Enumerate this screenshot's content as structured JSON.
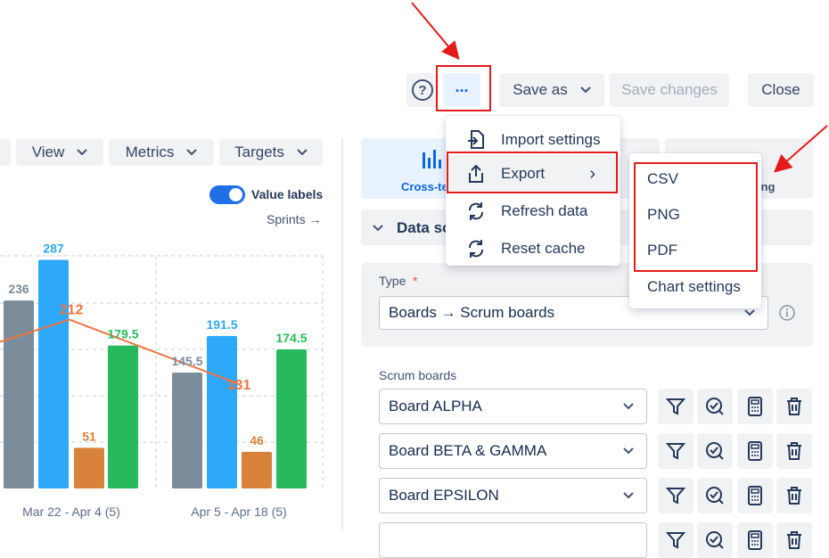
{
  "toolbar": {
    "help_icon": "help-circle-icon",
    "more_label": "...",
    "save_as_label": "Save as",
    "save_changes_label": "Save changes",
    "close_label": "Close"
  },
  "left_toolbar": {
    "view_label": "View",
    "metrics_label": "Metrics",
    "targets_label": "Targets"
  },
  "value_labels": {
    "label": "Value labels",
    "enabled": true
  },
  "sprints_link": "Sprints →",
  "chart_data": {
    "type": "bar",
    "categories": [
      "Mar 22 - Apr 4 (5)",
      "Apr 5 - Apr 18 (5)"
    ],
    "series": [
      {
        "color": "#7b8c9a",
        "values": [
          236,
          145.5
        ]
      },
      {
        "color": "#2ea8f8",
        "values": [
          287,
          191.5
        ]
      },
      {
        "color": "#d9823b",
        "values": [
          51,
          46
        ]
      },
      {
        "color": "#27ba5c",
        "values": [
          179.5,
          174.5
        ]
      }
    ],
    "line_series": {
      "color": "#f07542",
      "values": [
        212,
        131
      ]
    },
    "value_labels": {
      "group1": [
        "236",
        "287",
        "51",
        "179.5"
      ],
      "group2": [
        "145.5",
        "191.5",
        "46",
        "174.5"
      ],
      "line": [
        "212",
        "131"
      ]
    },
    "ylim": [
      0,
      320
    ],
    "grid": true
  },
  "right_panel": {
    "tab_left_label": "Cross-te",
    "tab_right_label": "ing",
    "data_section_label": "Data so",
    "type_label": "Type",
    "type_required": "*",
    "type_value": "Boards → Scrum boards",
    "scrum_boards_label": "Scrum boards",
    "boards": [
      "Board ALPHA",
      "Board BETA & GAMMA",
      "Board EPSILON"
    ]
  },
  "more_menu": {
    "items": [
      {
        "label": "Import settings",
        "icon": "import-icon"
      },
      {
        "label": "Export",
        "icon": "export-icon",
        "submenu_arrow": "›"
      },
      {
        "label": "Refresh data",
        "icon": "refresh-icon"
      },
      {
        "label": "Reset cache",
        "icon": "reset-icon"
      }
    ]
  },
  "export_submenu": {
    "items": [
      "CSV",
      "PNG",
      "PDF",
      "Chart settings"
    ]
  },
  "colors": {
    "accent": "#0c66e4",
    "annotation_red": "#e31b1b",
    "button_bg": "#f1f2f4",
    "tab_active_bg": "#e9f2ff"
  }
}
